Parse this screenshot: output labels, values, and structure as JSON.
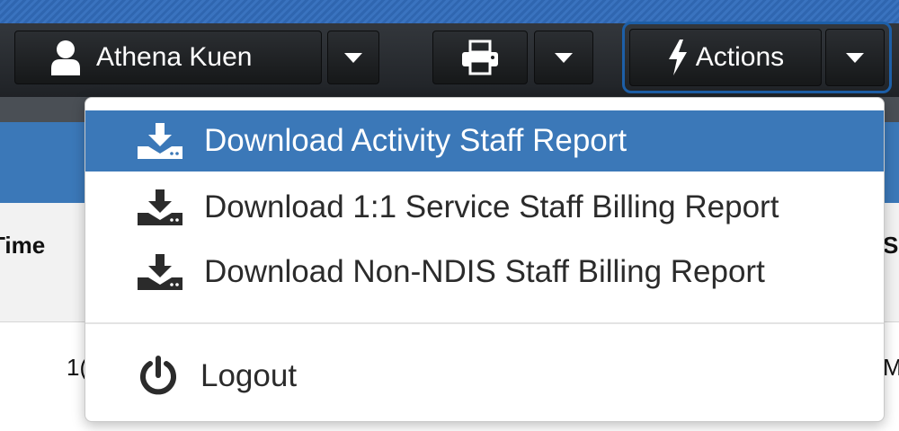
{
  "toolbar": {
    "user_name": "Athena Kuen",
    "actions_label": "Actions"
  },
  "table": {
    "header_left": "Time",
    "header_right": "S",
    "cell_left": "1(",
    "cell_right": "M"
  },
  "menu": {
    "items": [
      {
        "label": "Download Activity Staff Report",
        "icon": "download-icon",
        "active": true
      },
      {
        "label": "Download 1:1 Service Staff Billing Report",
        "icon": "download-icon"
      },
      {
        "label": "Download Non-NDIS Staff Billing Report",
        "icon": "download-icon"
      }
    ],
    "logout_label": "Logout",
    "logout_icon": "power-icon"
  },
  "colors": {
    "accent": "#3b78b8",
    "toolbar": "#1f2226",
    "focus_ring": "#1d5fa8"
  }
}
